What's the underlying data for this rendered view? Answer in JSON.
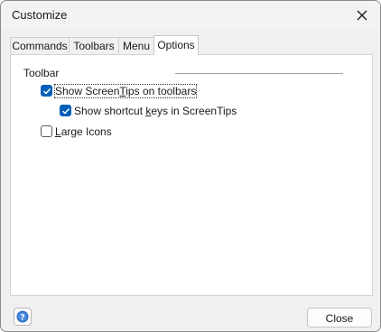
{
  "window": {
    "title": "Customize"
  },
  "tabs": [
    {
      "label": "Commands",
      "active": false
    },
    {
      "label": "Toolbars",
      "active": false
    },
    {
      "label": "Menu",
      "active": false
    },
    {
      "label": "Options",
      "active": true
    }
  ],
  "options": {
    "group_label": "Toolbar",
    "show_screentips": {
      "label_prefix": "Show Screen",
      "label_accel": "T",
      "label_suffix": "ips on toolbars",
      "checked": true
    },
    "show_shortcut_keys": {
      "label_prefix": "Show shortcut ",
      "label_accel": "k",
      "label_suffix": "eys in ScreenTips",
      "checked": true
    },
    "large_icons": {
      "label_prefix": "",
      "label_accel": "L",
      "label_suffix": "arge Icons",
      "checked": false
    }
  },
  "footer": {
    "close_label": "Close"
  },
  "icons": {
    "close": "close-x-icon",
    "help": "help-question-icon",
    "check": "checkmark-icon"
  },
  "colors": {
    "accent": "#005fb8",
    "dialog_bg": "#f0f0f0",
    "panel_bg": "#ffffff"
  }
}
